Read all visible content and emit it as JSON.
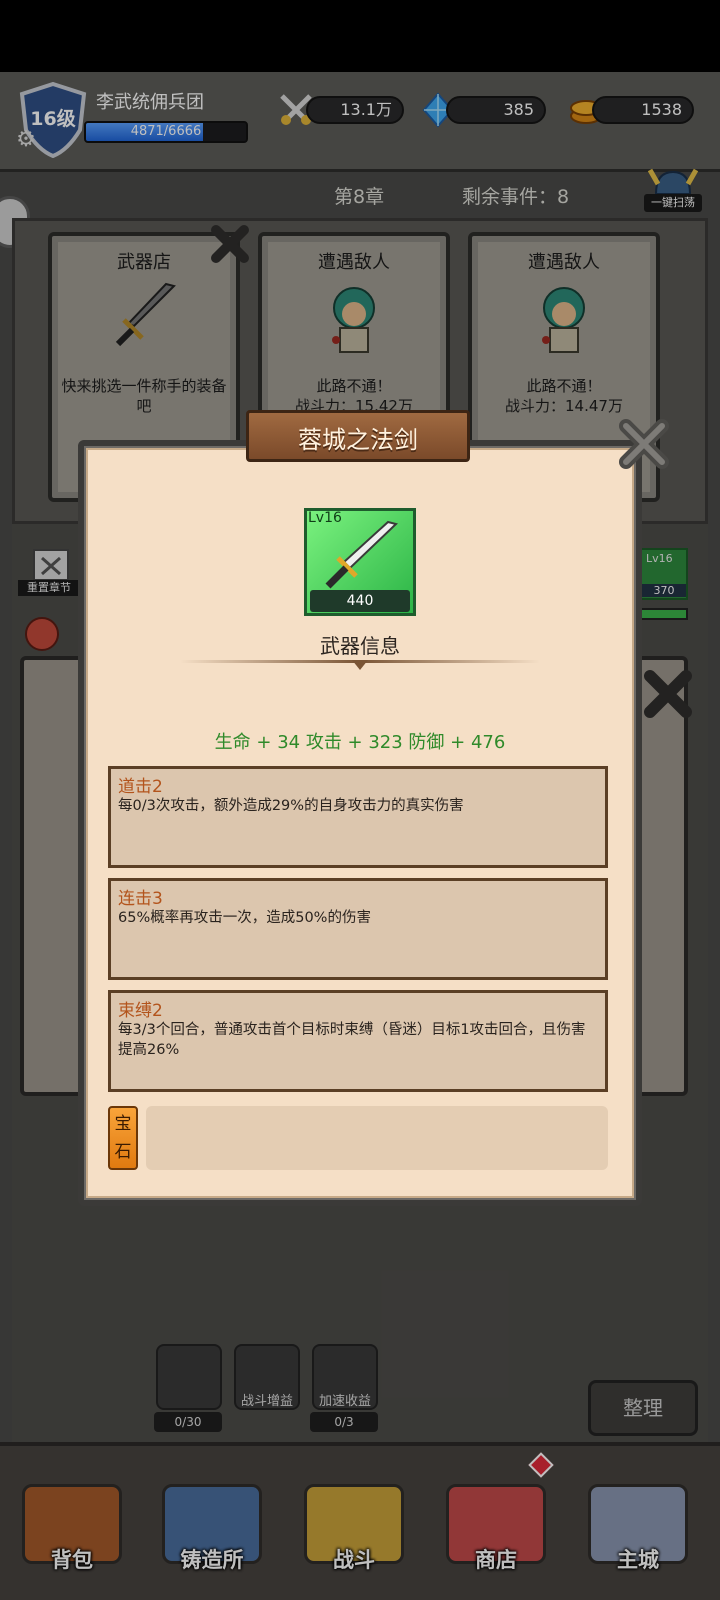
{
  "player": {
    "level_label": "16级",
    "team_name": "李武统佣兵团",
    "xp_text": "4871/6666",
    "xp_current": 4871,
    "xp_max": 6666
  },
  "resources": {
    "power": "13.1万",
    "gems": "385",
    "gold": "1538"
  },
  "chapter": {
    "title": "第8章",
    "events_remaining": "剩余事件：8",
    "sweep_label": "一键扫荡"
  },
  "cards": [
    {
      "title": "武器店",
      "desc": "快来挑选一件称手的装备吧"
    },
    {
      "title": "遭遇敌人",
      "desc": "此路不通！\n战斗力：15.42万"
    },
    {
      "title": "遭遇敌人",
      "desc": "此路不通！\n战斗力：14.47万"
    }
  ],
  "side": {
    "reset_label": "重置章节",
    "mini_lv": "Lv16",
    "mini_num": "370"
  },
  "modal": {
    "title": "蓉城之法剑",
    "item_level": "Lv16",
    "item_power": "440",
    "info_title": "武器信息",
    "stats": "生命 + 34 攻击 + 323 防御 + 476",
    "skills": [
      {
        "name": "道击2",
        "desc": "每0/3次攻击，额外造成29%的自身攻击力的真实伤害"
      },
      {
        "name": "连击3",
        "desc": "65%概率再攻击一次，造成50%的伤害"
      },
      {
        "name": "束缚2",
        "desc": "每3/3个回合，普通攻击首个目标时束缚（昏迷）目标1攻击回合，且伤害提高26%"
      }
    ],
    "gem_label": "宝石"
  },
  "bottom_tools": {
    "tv_count": "0/30",
    "boost_label": "战斗增益",
    "speed_label": "加速收益",
    "speed_count": "0/3",
    "sort_label": "整理"
  },
  "nav": [
    {
      "label": "背包",
      "icon": "backpack-icon"
    },
    {
      "label": "铸造所",
      "icon": "anvil-icon"
    },
    {
      "label": "战斗",
      "icon": "crossed-swords-icon"
    },
    {
      "label": "商店",
      "icon": "shop-icon"
    },
    {
      "label": "主城",
      "icon": "castle-icon"
    }
  ],
  "colors": {
    "stat_green": "#2f8a2a",
    "skill_orange": "#b3541c",
    "rarity_green": "#2bb446"
  }
}
